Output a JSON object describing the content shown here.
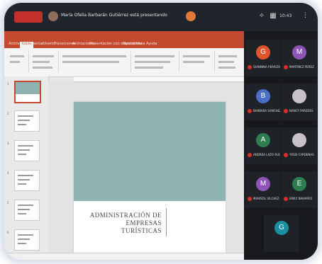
{
  "topbar": {
    "app_chip": "",
    "presenter_text": "María Ofelia Barbarán Gutiérrez está presentando",
    "notification_text": "",
    "time": "10:43"
  },
  "powerpoint": {
    "title_text": "",
    "tabs": [
      "Archivo",
      "Inicio",
      "Insertar",
      "Diseño",
      "Transiciones",
      "Animaciones",
      "Presentación con diapositivas",
      "Revisar",
      "Vista",
      "Ayuda"
    ],
    "active_tab_index": 1,
    "thumbnail_numbers": [
      "1",
      "2",
      "3",
      "4",
      "5",
      "6"
    ],
    "slide": {
      "title": "ADMINISTRACIÓN DE EMPRESAS TURÍSTICAS",
      "subtitle": ""
    },
    "accent_color": "#c3492f",
    "slide_band_color": "#8fb3b1"
  },
  "participants": [
    {
      "initial": "G",
      "name": "GIANNINA PERALTA",
      "color": "#e0552b"
    },
    {
      "initial": "M",
      "name": "MARTINEZ PEREZ",
      "color": "#8e55b6"
    },
    {
      "initial": "B",
      "name": "BARBARA SANCHEZ",
      "color": "#4a6fc9"
    },
    {
      "initial": "",
      "name": "NANCY PAREDES",
      "color": "#c9c1c8",
      "photo": true
    },
    {
      "initial": "A",
      "name": "ANDREA LAZO RUIZ",
      "color": "#2e7d4f"
    },
    {
      "initial": "",
      "name": "YESSI CARDENAS",
      "color": "#c9c1c8",
      "photo": true
    },
    {
      "initial": "M",
      "name": "MARISOL VILCHEZ",
      "color": "#8e55b6"
    },
    {
      "initial": "E",
      "name": "EMILY NAVARRO",
      "color": "#2e7d4f"
    },
    {
      "initial": "G",
      "name": "",
      "color": "#1a8fa0"
    }
  ]
}
